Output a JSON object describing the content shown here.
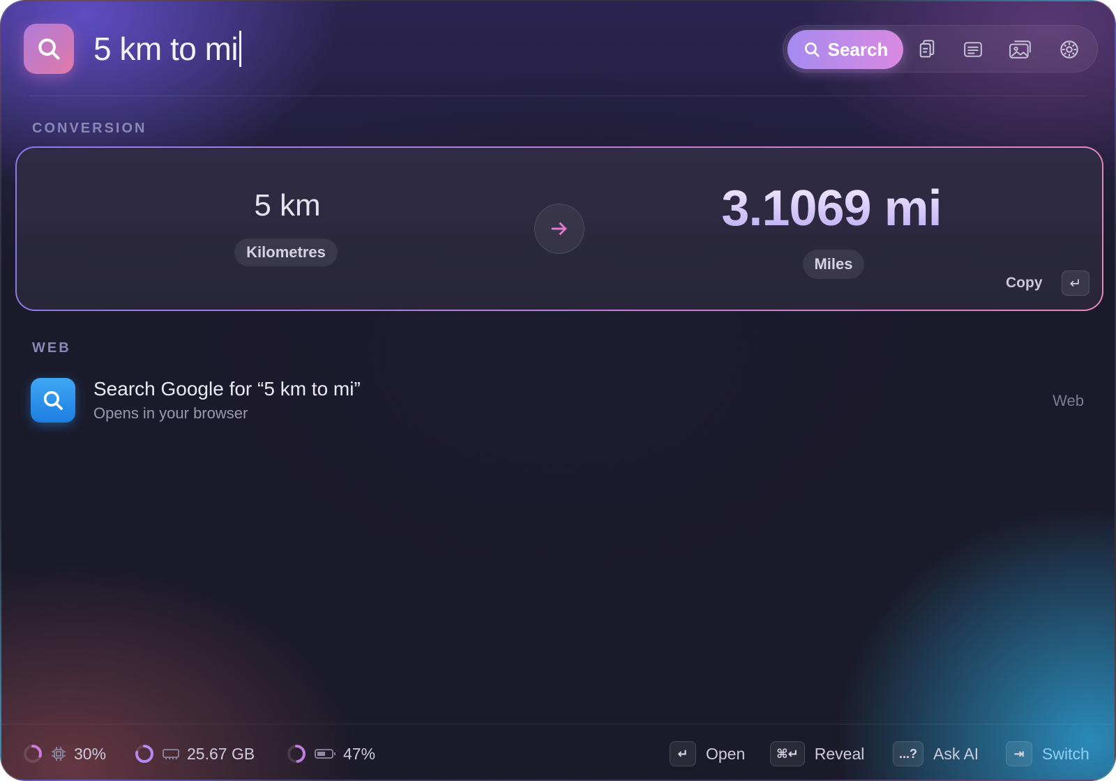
{
  "search": {
    "query": "5 km to mi",
    "mode_label": "Search",
    "toolbar_icons": [
      "clipboard-icon",
      "notes-icon",
      "gallery-icon",
      "settings-icon"
    ]
  },
  "sections": {
    "conversion_label": "CONVERSION",
    "web_label": "WEB"
  },
  "conversion": {
    "from_value": "5 km",
    "from_unit": "Kilometres",
    "to_value": "3.1069 mi",
    "to_unit": "Miles",
    "copy_label": "Copy",
    "copy_key": "↵"
  },
  "web_result": {
    "title": "Search Google for “5 km to mi”",
    "subtitle": "Opens in your browser",
    "tag": "Web"
  },
  "footer": {
    "stats": [
      {
        "icon": "cpu-icon",
        "value": "30%",
        "progress": 0.3
      },
      {
        "icon": "memory-icon",
        "value": "25.67 GB",
        "progress": 0.78
      },
      {
        "icon": "battery-icon",
        "value": "47%",
        "progress": 0.47
      }
    ],
    "actions": [
      {
        "key": "↵",
        "label": "Open"
      },
      {
        "key": "⌘↵",
        "label": "Reveal"
      },
      {
        "key": "...?",
        "label": "Ask AI"
      },
      {
        "key": "⇥",
        "label": "Switch"
      }
    ]
  },
  "colors": {
    "accent_start": "#a68af0",
    "accent_end": "#d88ae0",
    "web_icon": "#2a92ea",
    "switch_accent": "#7fc8f0"
  }
}
